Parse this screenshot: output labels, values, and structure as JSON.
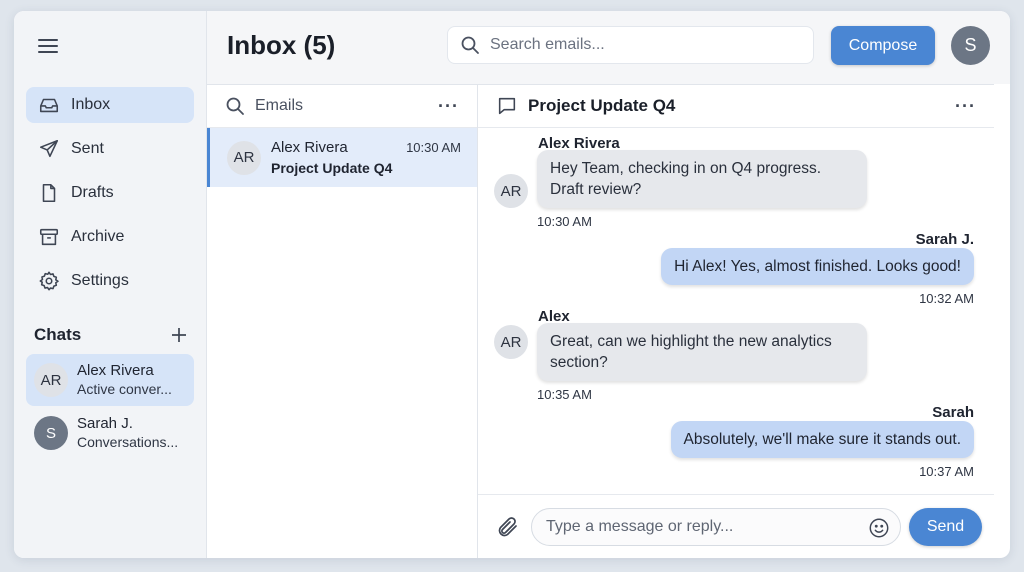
{
  "sidebar": {
    "menu_icon": "hamburger-icon",
    "nav": [
      {
        "label": "Inbox",
        "icon": "inbox-icon",
        "active": true
      },
      {
        "label": "Sent",
        "icon": "send-icon"
      },
      {
        "label": "Drafts",
        "icon": "document-icon"
      },
      {
        "label": "Archive",
        "icon": "archive-icon"
      },
      {
        "label": "Settings",
        "icon": "gear-icon"
      }
    ],
    "chats_title": "Chats",
    "chats": [
      {
        "initials": "AR",
        "name": "Alex Rivera",
        "subtitle": "Active conver...",
        "active": true
      },
      {
        "initials": "S",
        "name": "Sarah J.",
        "subtitle": "Conversations..."
      }
    ]
  },
  "header": {
    "title": "Inbox (5)",
    "search_placeholder": "Search emails...",
    "compose_label": "Compose",
    "user_initial": "S"
  },
  "email_list": {
    "header_label": "Emails",
    "more": "···",
    "items": [
      {
        "initials": "AR",
        "sender": "Alex Rivera",
        "subject": "Project Update Q4",
        "time": "10:30 AM"
      }
    ]
  },
  "conversation": {
    "title": "Project Update Q4",
    "more": "···",
    "messages": [
      {
        "sender": "Alex Rivera",
        "initials": "AR",
        "text": "Hey Team, checking in on Q4 progress. Draft review?",
        "time": "10:30 AM",
        "direction": "in"
      },
      {
        "sender": "Sarah J.",
        "text": "Hi Alex! Yes, almost finished. Looks good!",
        "time": "10:32 AM",
        "direction": "out"
      },
      {
        "sender": "Alex",
        "initials": "AR",
        "text": "Great, can we highlight the new analytics section?",
        "time": "10:35 AM",
        "direction": "in"
      },
      {
        "sender": "Sarah",
        "text": "Absolutely, we'll make sure it stands out.",
        "time": "10:37 AM",
        "direction": "out"
      }
    ],
    "input_placeholder": "Type a message or reply...",
    "send_label": "Send"
  },
  "colors": {
    "accent": "#4a86d3",
    "active_bg": "#d6e4f8",
    "outgoing_bubble": "#c2d6f5",
    "incoming_bubble": "#e6e8ec"
  }
}
